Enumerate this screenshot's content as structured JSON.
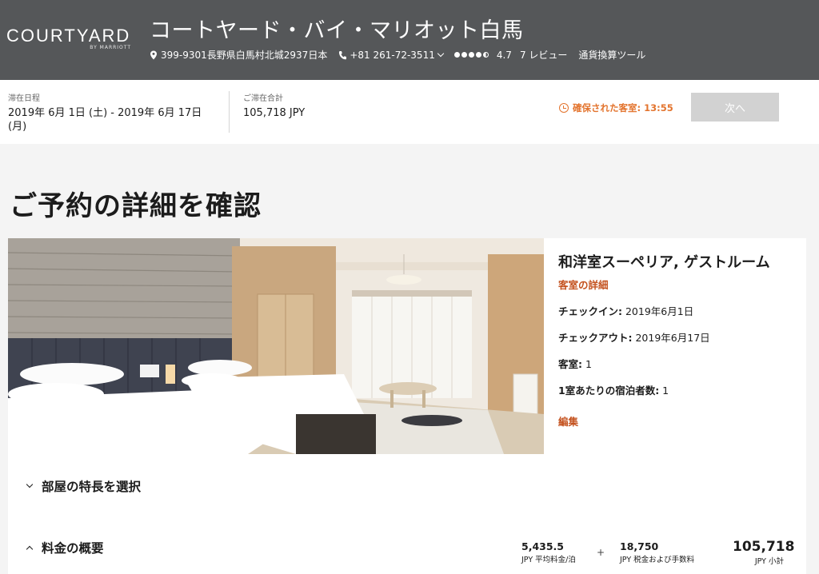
{
  "header": {
    "brand": "COURTYARD",
    "brand_sub": "BY MARRIOTT",
    "hotel_name": "コートヤード・バイ・マリオット白馬",
    "address": "399-9301長野県白馬村北城2937日本",
    "phone": "+81 261-72-3511",
    "rating": "4.7",
    "reviews": "7 レビュー",
    "currency_tool": "通貨換算ツール"
  },
  "stay": {
    "dates_label": "滞在日程",
    "dates_value": "2019年 6月 1日 (土) - 2019年 6月 17日 (月)",
    "total_label": "ご滞在合計",
    "total_value": "105,718 JPY",
    "hold_text": "確保された客室: 13:55",
    "next_label": "次へ"
  },
  "page_title": "ご予約の詳細を確認",
  "room": {
    "title": "和洋室スーペリア, ゲストルーム",
    "details_link": "客室の詳細",
    "checkin_label": "チェックイン:",
    "checkin_value": " 2019年6月1日",
    "checkout_label": "チェックアウト:",
    "checkout_value": " 2019年6月17日",
    "rooms_label": "客室:",
    "rooms_value": " 1",
    "guests_label": "1室あたりの宿泊者数:",
    "guests_value": " 1",
    "edit_label": "編集"
  },
  "sections": {
    "features": "部屋の特長を選択",
    "summary": "料金の概要"
  },
  "summary": {
    "avg_value": "5,435.5",
    "avg_label": "JPY 平均料金/泊",
    "plus": "+",
    "tax_value": "18,750",
    "tax_label": "JPY 税金および手数料",
    "subtotal_value": "105,718",
    "subtotal_label": "JPY 小計"
  },
  "colors": {
    "header_bg": "#555759",
    "accent": "#c4521f",
    "hold": "#e3742e",
    "button_disabled": "#d2d2d2"
  }
}
